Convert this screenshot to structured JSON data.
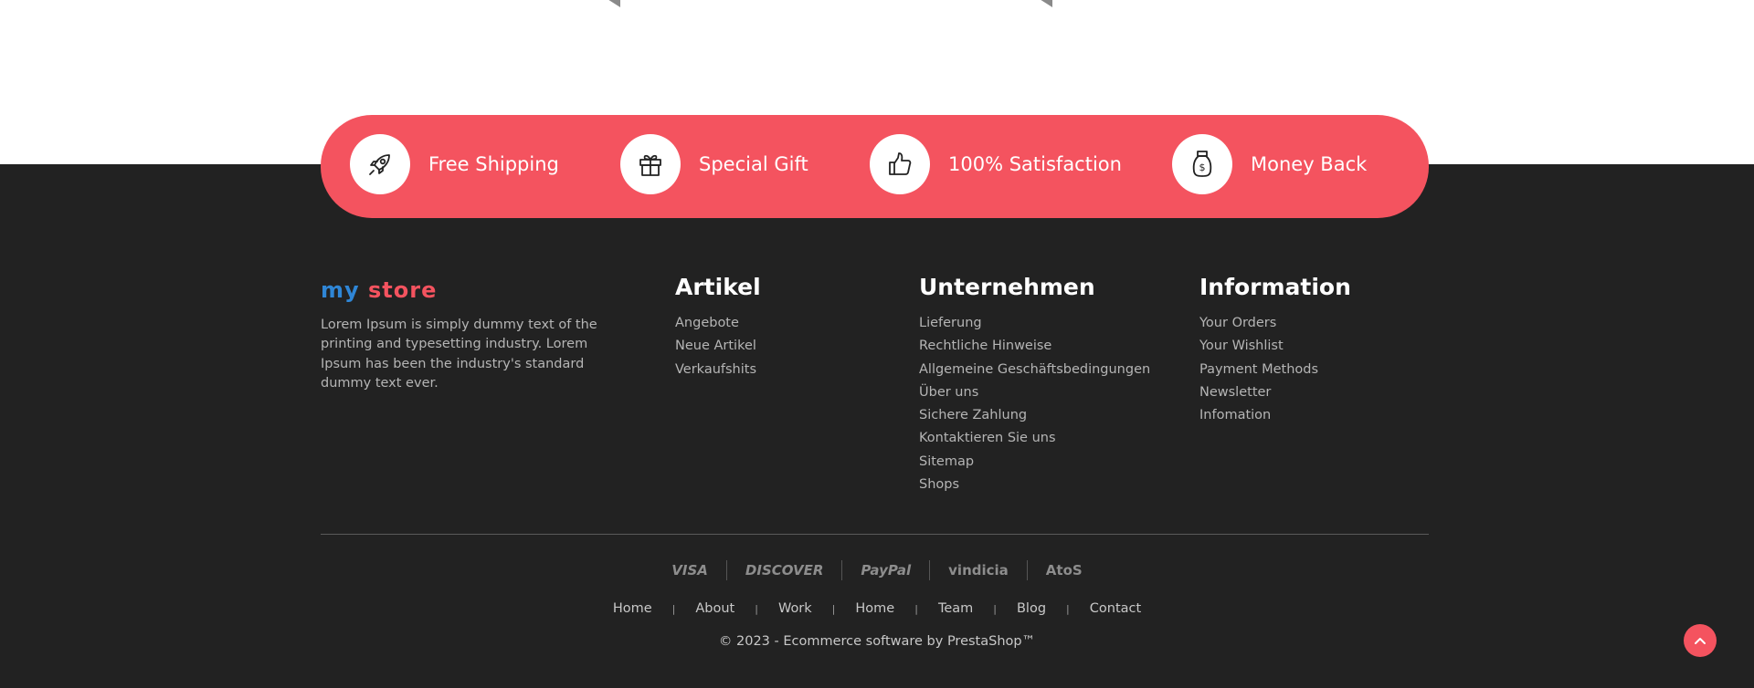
{
  "features": [
    {
      "label": "Free Shipping",
      "icon": "rocket-icon"
    },
    {
      "label": "Special Gift",
      "icon": "gift-icon"
    },
    {
      "label": "100% Satisfaction",
      "icon": "thumbs-up-icon"
    },
    {
      "label": "Money Back",
      "icon": "money-bag-icon"
    }
  ],
  "logo": {
    "text": "my store"
  },
  "about": {
    "text": "Lorem Ipsum is simply dummy text of the printing and typesetting industry. Lorem Ipsum has been the industry's standard dummy text ever."
  },
  "columns": {
    "artikel": {
      "title": "Artikel",
      "links": [
        "Angebote",
        "Neue Artikel",
        "Verkaufshits"
      ]
    },
    "unternehmen": {
      "title": "Unternehmen",
      "links": [
        "Lieferung",
        "Rechtliche Hinweise",
        "Allgemeine Geschäftsbedingungen",
        "Über uns",
        "Sichere Zahlung",
        "Kontaktieren Sie uns",
        "Sitemap",
        "Shops"
      ]
    },
    "information": {
      "title": "Information",
      "links": [
        "Your Orders",
        "Your Wishlist",
        "Payment Methods",
        "Newsletter",
        "Infomation"
      ]
    }
  },
  "payments": [
    "VISA",
    "DISCOVER",
    "PayPal",
    "vindicia",
    "AtoS"
  ],
  "bottom_nav": [
    "Home",
    "About",
    "Work",
    "Home",
    "Team",
    "Blog",
    "Contact"
  ],
  "bottom_nav_separator": "|",
  "copyright": "© 2023 - Ecommerce software by PrestaShop™",
  "colors": {
    "accent": "#f4535f",
    "footer_bg": "#222222",
    "link": "#b5b5b5",
    "logo_blue": "#2f86d6",
    "logo_red": "#f4535f"
  }
}
